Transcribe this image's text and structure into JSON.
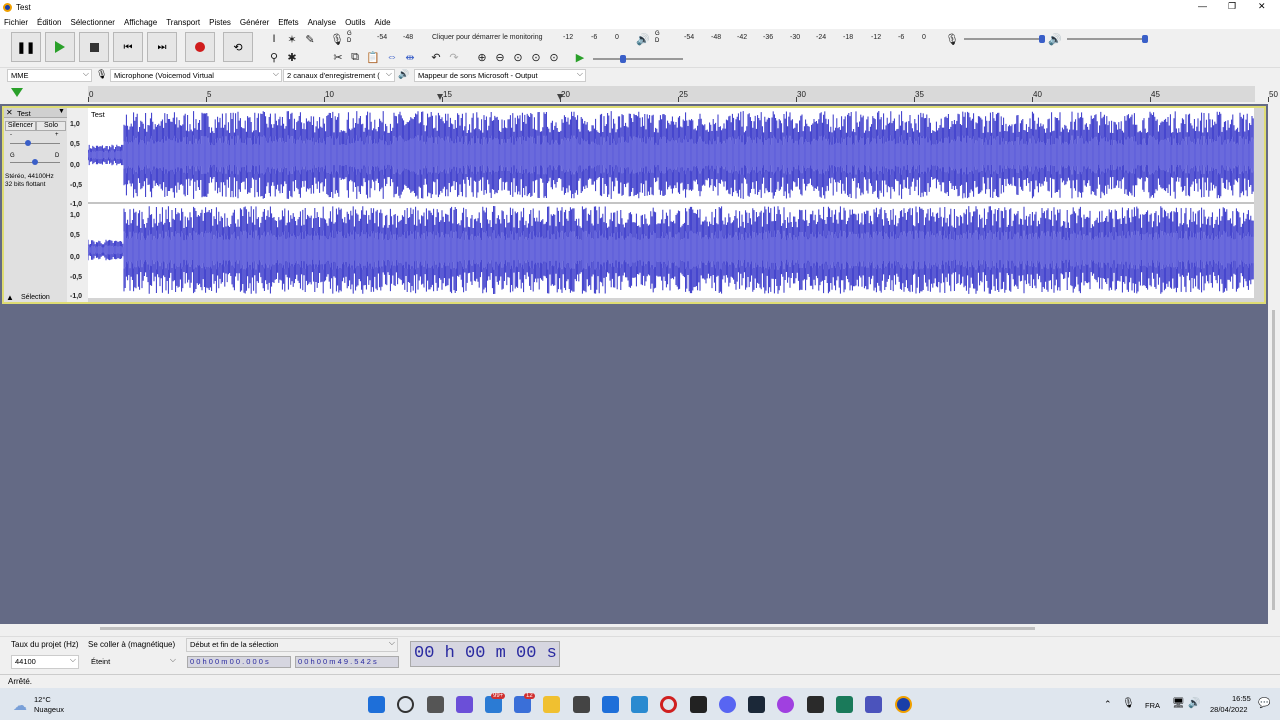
{
  "window": {
    "title": "Test"
  },
  "menu": [
    "Fichier",
    "Édition",
    "Sélectionner",
    "Affichage",
    "Transport",
    "Pistes",
    "Générer",
    "Effets",
    "Analyse",
    "Outils",
    "Aide"
  ],
  "window_controls": {
    "minimize": "—",
    "maximize": "❐",
    "close": "✕"
  },
  "record_meter": {
    "ticks": [
      "-54",
      "-48",
      "Cliquer pour démarrer le monitoring",
      "-12",
      "-6",
      "0"
    ],
    "lr": "G\nD"
  },
  "play_meter": {
    "ticks": [
      "-54",
      "-48",
      "-42",
      "-36",
      "-30",
      "-24",
      "-18",
      "-12",
      "-6",
      "0"
    ]
  },
  "devices": {
    "host": "MME",
    "mic": "Microphone (Voicemod Virtual",
    "channels": "2 canaux d'enregistrement (",
    "output": "Mappeur de sons Microsoft - Output"
  },
  "ruler": {
    "labels": [
      "0",
      "5",
      "10",
      "15",
      "20",
      "25",
      "30",
      "35",
      "40",
      "45",
      "50"
    ]
  },
  "track": {
    "name": "Test",
    "clip_name": "Test",
    "mute": "Silencer",
    "solo": "Solo",
    "gain_minus": "-",
    "gain_plus": "+",
    "pan_left": "G",
    "pan_right": "D",
    "info": "Stéréo, 44100Hz\n32 bits flottant",
    "select_label": "Sélection",
    "scale": [
      "1,0",
      "0,5",
      "0,0",
      "-0,5",
      "-1,0",
      "1,0",
      "0,5",
      "0,0",
      "-0,5",
      "-1,0"
    ]
  },
  "selection_toolbar": {
    "rate_label": "Taux du projet (Hz)",
    "rate_value": "44100",
    "snap_label": "Se coller à (magnétique)",
    "snap_value": "Éteint",
    "mode": "Début et fin de la sélection",
    "start": "0 0 h 0 0 m 0 0 . 0 0 0 s",
    "end": "0 0 h 0 0 m 4 9 . 5 4 2 s",
    "position": "00 h 00 m 00 s"
  },
  "status": "Arrêté.",
  "taskbar": {
    "weather_temp": "12°C",
    "weather_desc": "Nuageux",
    "badge_mail": "99+",
    "badge_teams": "12",
    "lang": "FRA",
    "time": "16:55",
    "date": "28/04/2022"
  },
  "colors": {
    "waveform": "#3232c8",
    "waveform_rms": "#6464dc",
    "track_bg": "#d4d4d4",
    "project_bg": "#646a85",
    "selection_border": "#dedc74"
  }
}
